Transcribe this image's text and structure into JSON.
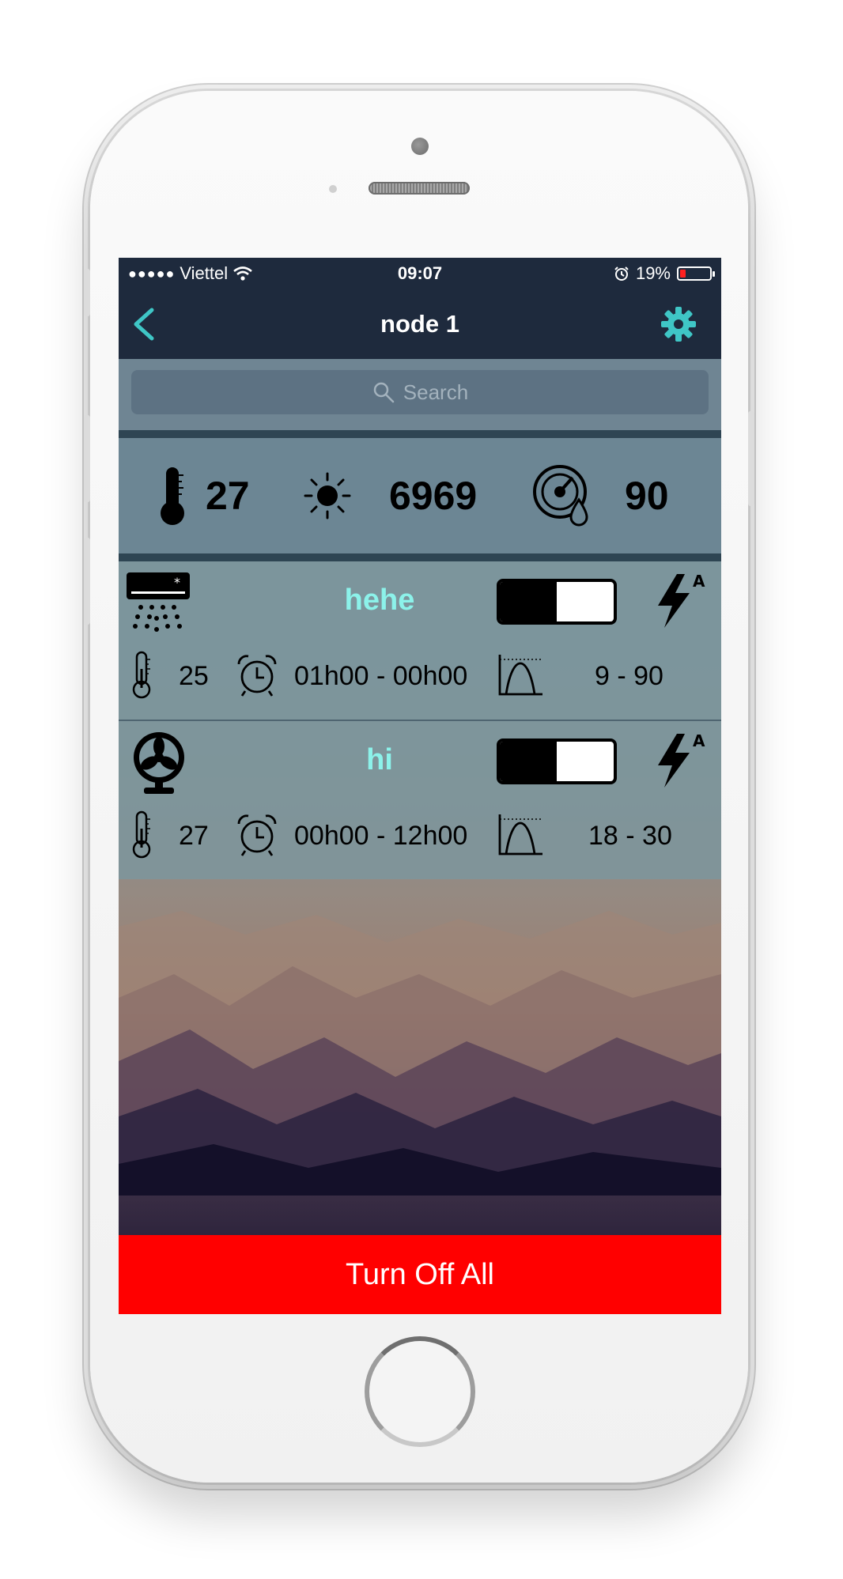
{
  "status_bar": {
    "carrier": "Viettel",
    "signal_dots": "●●●●●",
    "time": "09:07",
    "battery_percent": "19%",
    "battery_level": 0.19,
    "battery_color": "#ff2020"
  },
  "nav": {
    "title": "node 1",
    "back_icon": "chevron-left-icon",
    "settings_icon": "gear-icon",
    "accent": "#3fc6c6"
  },
  "search": {
    "placeholder": "Search"
  },
  "sensors": [
    {
      "icon": "thermometer-icon",
      "value": "27"
    },
    {
      "icon": "sun-icon",
      "value": "6969"
    },
    {
      "icon": "humidity-gauge-icon",
      "value": "90"
    }
  ],
  "devices": [
    {
      "icon": "air-conditioner-icon",
      "name": "hehe",
      "toggle_fill": 0.5,
      "temperature": "25",
      "schedule": "01h00 - 00h00",
      "range": "9 - 90"
    },
    {
      "icon": "fan-icon",
      "name": "hi",
      "toggle_fill": 0.5,
      "temperature": "27",
      "schedule": "00h00 - 12h00",
      "range": "18 - 30"
    }
  ],
  "turn_off_all": {
    "label": "Turn Off All",
    "color": "#ff0000"
  }
}
